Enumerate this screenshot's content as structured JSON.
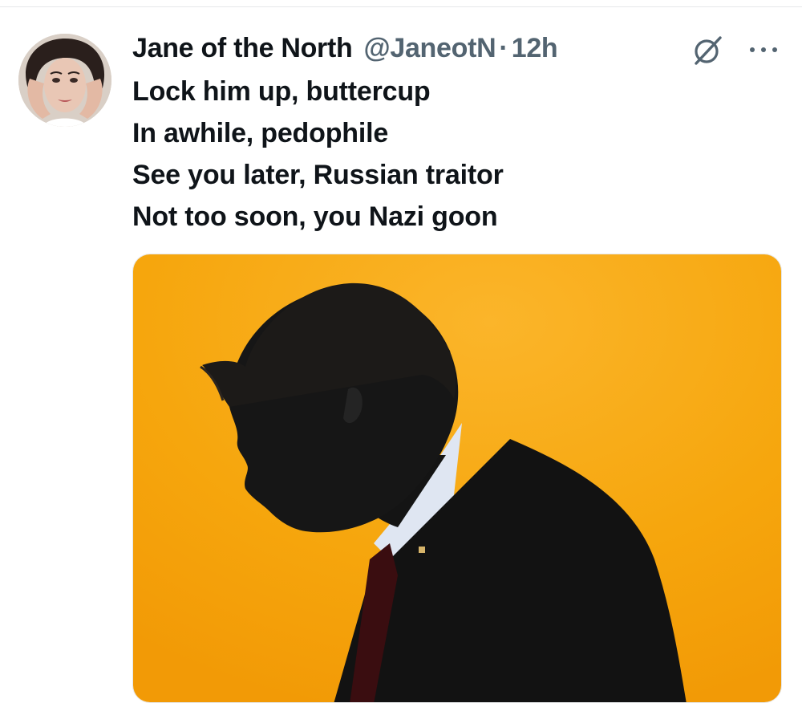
{
  "tweet": {
    "author": {
      "display_name": "Jane of the North",
      "handle": "@JaneotN",
      "avatar_icon": "avatar-photo"
    },
    "separator": "·",
    "time": "12h",
    "lines": [
      "Lock him up, buttercup",
      "In awhile, pedophile",
      "See you later, Russian traitor",
      "Not too soon, you Nazi goon"
    ],
    "actions": {
      "grok_icon": "grok-icon",
      "more_icon": "more-options-icon"
    },
    "media": {
      "type": "image",
      "background_color": "#f7a90f"
    }
  },
  "colors": {
    "text_primary": "#0f1419",
    "text_secondary": "#536471",
    "divider": "#e6e8ea",
    "media_orange": "#f7a90f",
    "silhouette": "#121212"
  }
}
